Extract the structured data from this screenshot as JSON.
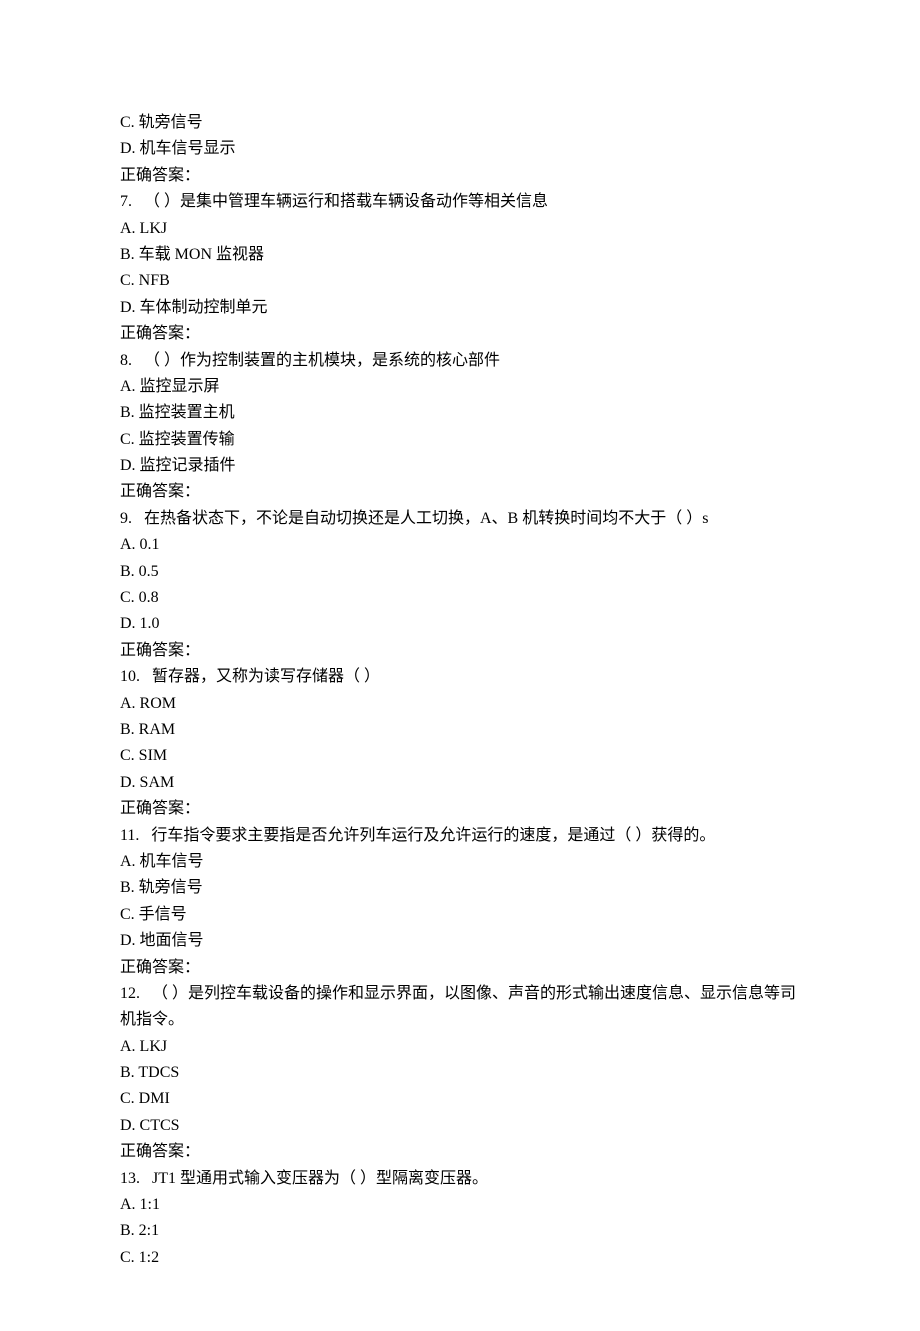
{
  "items": [
    {
      "pre": [
        "C. 轨旁信号",
        "D. 机车信号显示",
        "正确答案："
      ]
    },
    {
      "number": "7.",
      "question": "（  ）是集中管理车辆运行和搭载车辆设备动作等相关信息",
      "options": [
        "A. LKJ",
        "B. 车载 MON 监视器",
        "C. NFB",
        "D. 车体制动控制单元"
      ],
      "answer_label": "正确答案："
    },
    {
      "number": "8.",
      "question": "（  ）作为控制装置的主机模块，是系统的核心部件",
      "options": [
        "A. 监控显示屏",
        "B. 监控装置主机",
        "C. 监控装置传输",
        "D. 监控记录插件"
      ],
      "answer_label": "正确答案："
    },
    {
      "number": "9.",
      "question": "在热备状态下，不论是自动切换还是人工切换，A、B 机转换时间均不大于（  ）s",
      "options": [
        "A. 0.1",
        "B. 0.5",
        "C. 0.8",
        "D. 1.0"
      ],
      "answer_label": "正确答案："
    },
    {
      "number": "10.",
      "question": "暂存器，又称为读写存储器（  ）",
      "options": [
        "A. ROM",
        "B. RAM",
        "C. SIM",
        "D. SAM"
      ],
      "answer_label": "正确答案："
    },
    {
      "number": "11.",
      "question": "行车指令要求主要指是否允许列车运行及允许运行的速度，是通过（  ）获得的。",
      "options": [
        "A. 机车信号",
        "B. 轨旁信号",
        "C. 手信号",
        "D. 地面信号"
      ],
      "answer_label": "正确答案："
    },
    {
      "number": "12.",
      "question": "（  ）是列控车载设备的操作和显示界面，以图像、声音的形式输出速度信息、显示信息等司机指令。",
      "options": [
        "A. LKJ",
        "B. TDCS",
        "C. DMI",
        "D. CTCS"
      ],
      "answer_label": "正确答案："
    },
    {
      "number": "13.",
      "question": "JT1 型通用式输入变压器为（  ）型隔离变压器。",
      "options": [
        "A. 1:1",
        "B. 2:1",
        "C. 1:2"
      ],
      "answer_label": ""
    }
  ]
}
